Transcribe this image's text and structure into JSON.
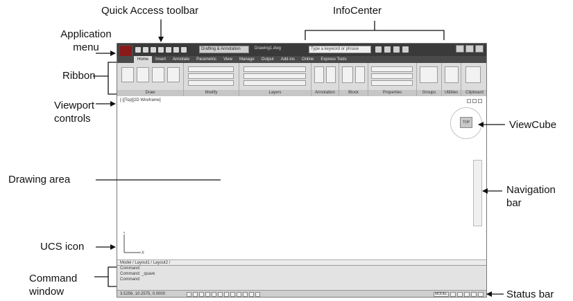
{
  "callouts": {
    "quick_access_toolbar": "Quick Access toolbar",
    "infocenter": "InfoCenter",
    "application_menu_line1": "Application",
    "application_menu_line2": "menu",
    "ribbon": "Ribbon",
    "viewport_controls_line1": "Viewport",
    "viewport_controls_line2": "controls",
    "viewcube": "ViewCube",
    "drawing_area": "Drawing area",
    "navigation_bar_line1": "Navigation",
    "navigation_bar_line2": "bar",
    "ucs_icon": "UCS icon",
    "command_window_line1": "Command",
    "command_window_line2": "window",
    "status_bar": "Status bar"
  },
  "screenshot": {
    "workspace_select": "Drafting & Annotation",
    "drawing_title": "Drawing1.dwg",
    "info_search_placeholder": "Type a keyword or phrase",
    "ribbon_tabs": [
      "Home",
      "Insert",
      "Annotate",
      "Parametric",
      "View",
      "Manage",
      "Output",
      "Add-ins",
      "Online",
      "Express Tools"
    ],
    "panels": [
      "Draw",
      "Modify",
      "Layers",
      "Annotation",
      "Block",
      "Properties",
      "Groups",
      "Utilities",
      "Clipboard"
    ],
    "viewport_label": "[-][Top][2D Wireframe]",
    "cube_face": "TOP",
    "layout_tabs": "Model / Layout1 / Layout2 /",
    "command_line_1": "Command:",
    "command_line_2": "Command: _qsave",
    "command_prompt": "Command:",
    "status_coords": "3.5256, 10.2575, 0.0000",
    "status_right": "MODEL"
  },
  "colors": {
    "title_bar": "#3a3a3a",
    "ribbon": "#dcdcdc",
    "application_button": "#8a1a1a"
  }
}
